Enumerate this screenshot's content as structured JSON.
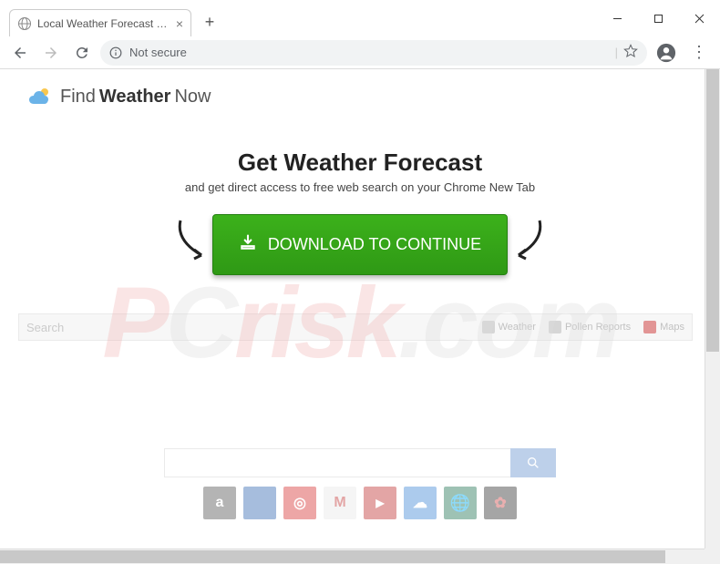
{
  "browser": {
    "tab_title": "Local Weather Forecast with acc",
    "address_label": "Not secure",
    "address_info_icon": "ⓘ"
  },
  "logo": {
    "part1": "Find",
    "part2": " Weather",
    "part3": " Now"
  },
  "headline": "Get Weather Forecast",
  "subhead": "and get direct access to free web search on your Chrome New Tab",
  "cta_label": "DOWNLOAD TO CONTINUE",
  "bg_search_placeholder": "Search",
  "bg_links": [
    {
      "label": "Weather"
    },
    {
      "label": "Pollen Reports"
    },
    {
      "label": "Maps"
    }
  ],
  "app_icons": [
    {
      "name": "amazon",
      "bg": "#5a5a5a",
      "glyph": "a"
    },
    {
      "name": "walmart",
      "bg": "#3b6fb6",
      "glyph": ""
    },
    {
      "name": "target",
      "bg": "#d83b3b",
      "glyph": "◎"
    },
    {
      "name": "gmail",
      "bg": "#eaeaea",
      "glyph": "M"
    },
    {
      "name": "youtube",
      "bg": "#c23a3a",
      "glyph": "▶"
    },
    {
      "name": "weather",
      "bg": "#4a8ed8",
      "glyph": "☁"
    },
    {
      "name": "browser",
      "bg": "#2a7a5a",
      "glyph": "🌐"
    },
    {
      "name": "app8",
      "bg": "#3a3a3a",
      "glyph": "✿"
    }
  ],
  "watermark_parts": {
    "p": "P",
    "c": "C",
    "risk": "risk",
    "com": ".com"
  }
}
